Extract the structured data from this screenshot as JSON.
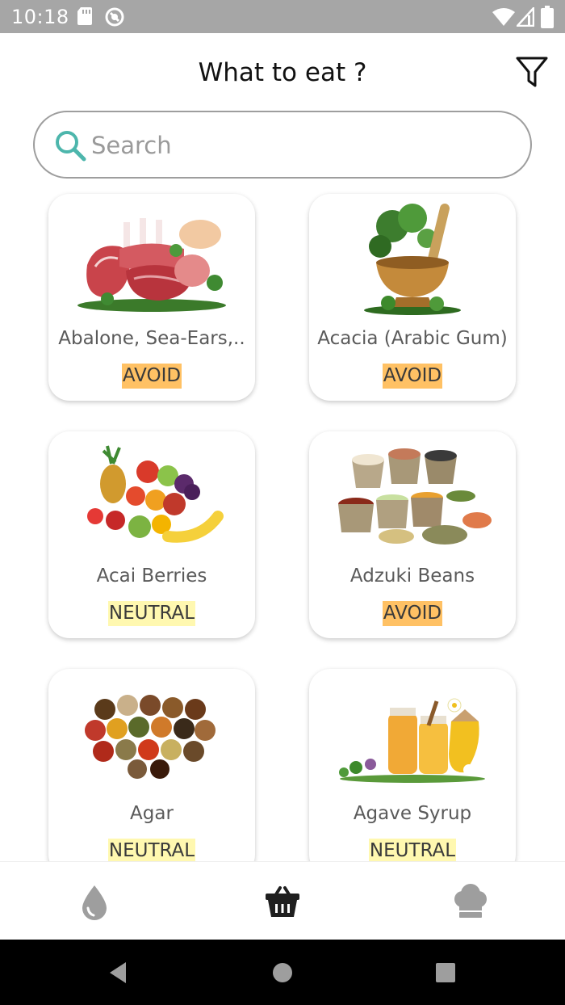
{
  "status_bar": {
    "time": "10:18"
  },
  "header": {
    "title": "What to eat ?"
  },
  "search": {
    "placeholder": "Search",
    "value": ""
  },
  "foods": [
    {
      "name": "Abalone, Sea-Ears,..",
      "status": "AVOID",
      "image": "meat-image"
    },
    {
      "name": "Acacia (Arabic Gum)",
      "status": "AVOID",
      "image": "herbs-mortar-image"
    },
    {
      "name": "Acai Berries",
      "status": "NEUTRAL",
      "image": "fruits-image"
    },
    {
      "name": "Adzuki Beans",
      "status": "AVOID",
      "image": "beans-sacks-image"
    },
    {
      "name": "Agar",
      "status": "NEUTRAL",
      "image": "spices-image"
    },
    {
      "name": "Agave Syrup",
      "status": "NEUTRAL",
      "image": "honey-jars-image"
    }
  ],
  "status_colors": {
    "AVOID": "#ffc164",
    "NEUTRAL": "#fff8b0"
  },
  "bottom_nav": {
    "items": [
      {
        "icon": "drop-icon",
        "active": false
      },
      {
        "icon": "basket-icon",
        "active": true
      },
      {
        "icon": "chef-hat-icon",
        "active": false
      }
    ]
  }
}
